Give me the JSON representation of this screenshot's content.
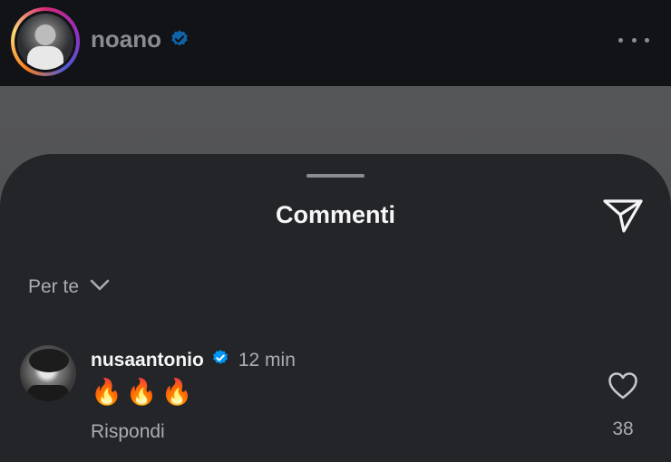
{
  "header": {
    "username": "noano",
    "verified": true
  },
  "sheet": {
    "title": "Commenti",
    "sort_label": "Per te"
  },
  "comments": [
    {
      "username": "nusaantonio",
      "verified": true,
      "time": "12 min",
      "text": "🔥🔥🔥",
      "reply_label": "Rispondi",
      "likes": "38"
    }
  ],
  "colors": {
    "verified": "#0095f6",
    "sheet_background": "#232529",
    "secondary_text": "#a9acb1"
  },
  "icons": {
    "verified": "verified-badge-icon",
    "more": "more-options-icon",
    "send": "send-icon",
    "sort": "chevron-down-icon",
    "like": "heart-icon"
  }
}
